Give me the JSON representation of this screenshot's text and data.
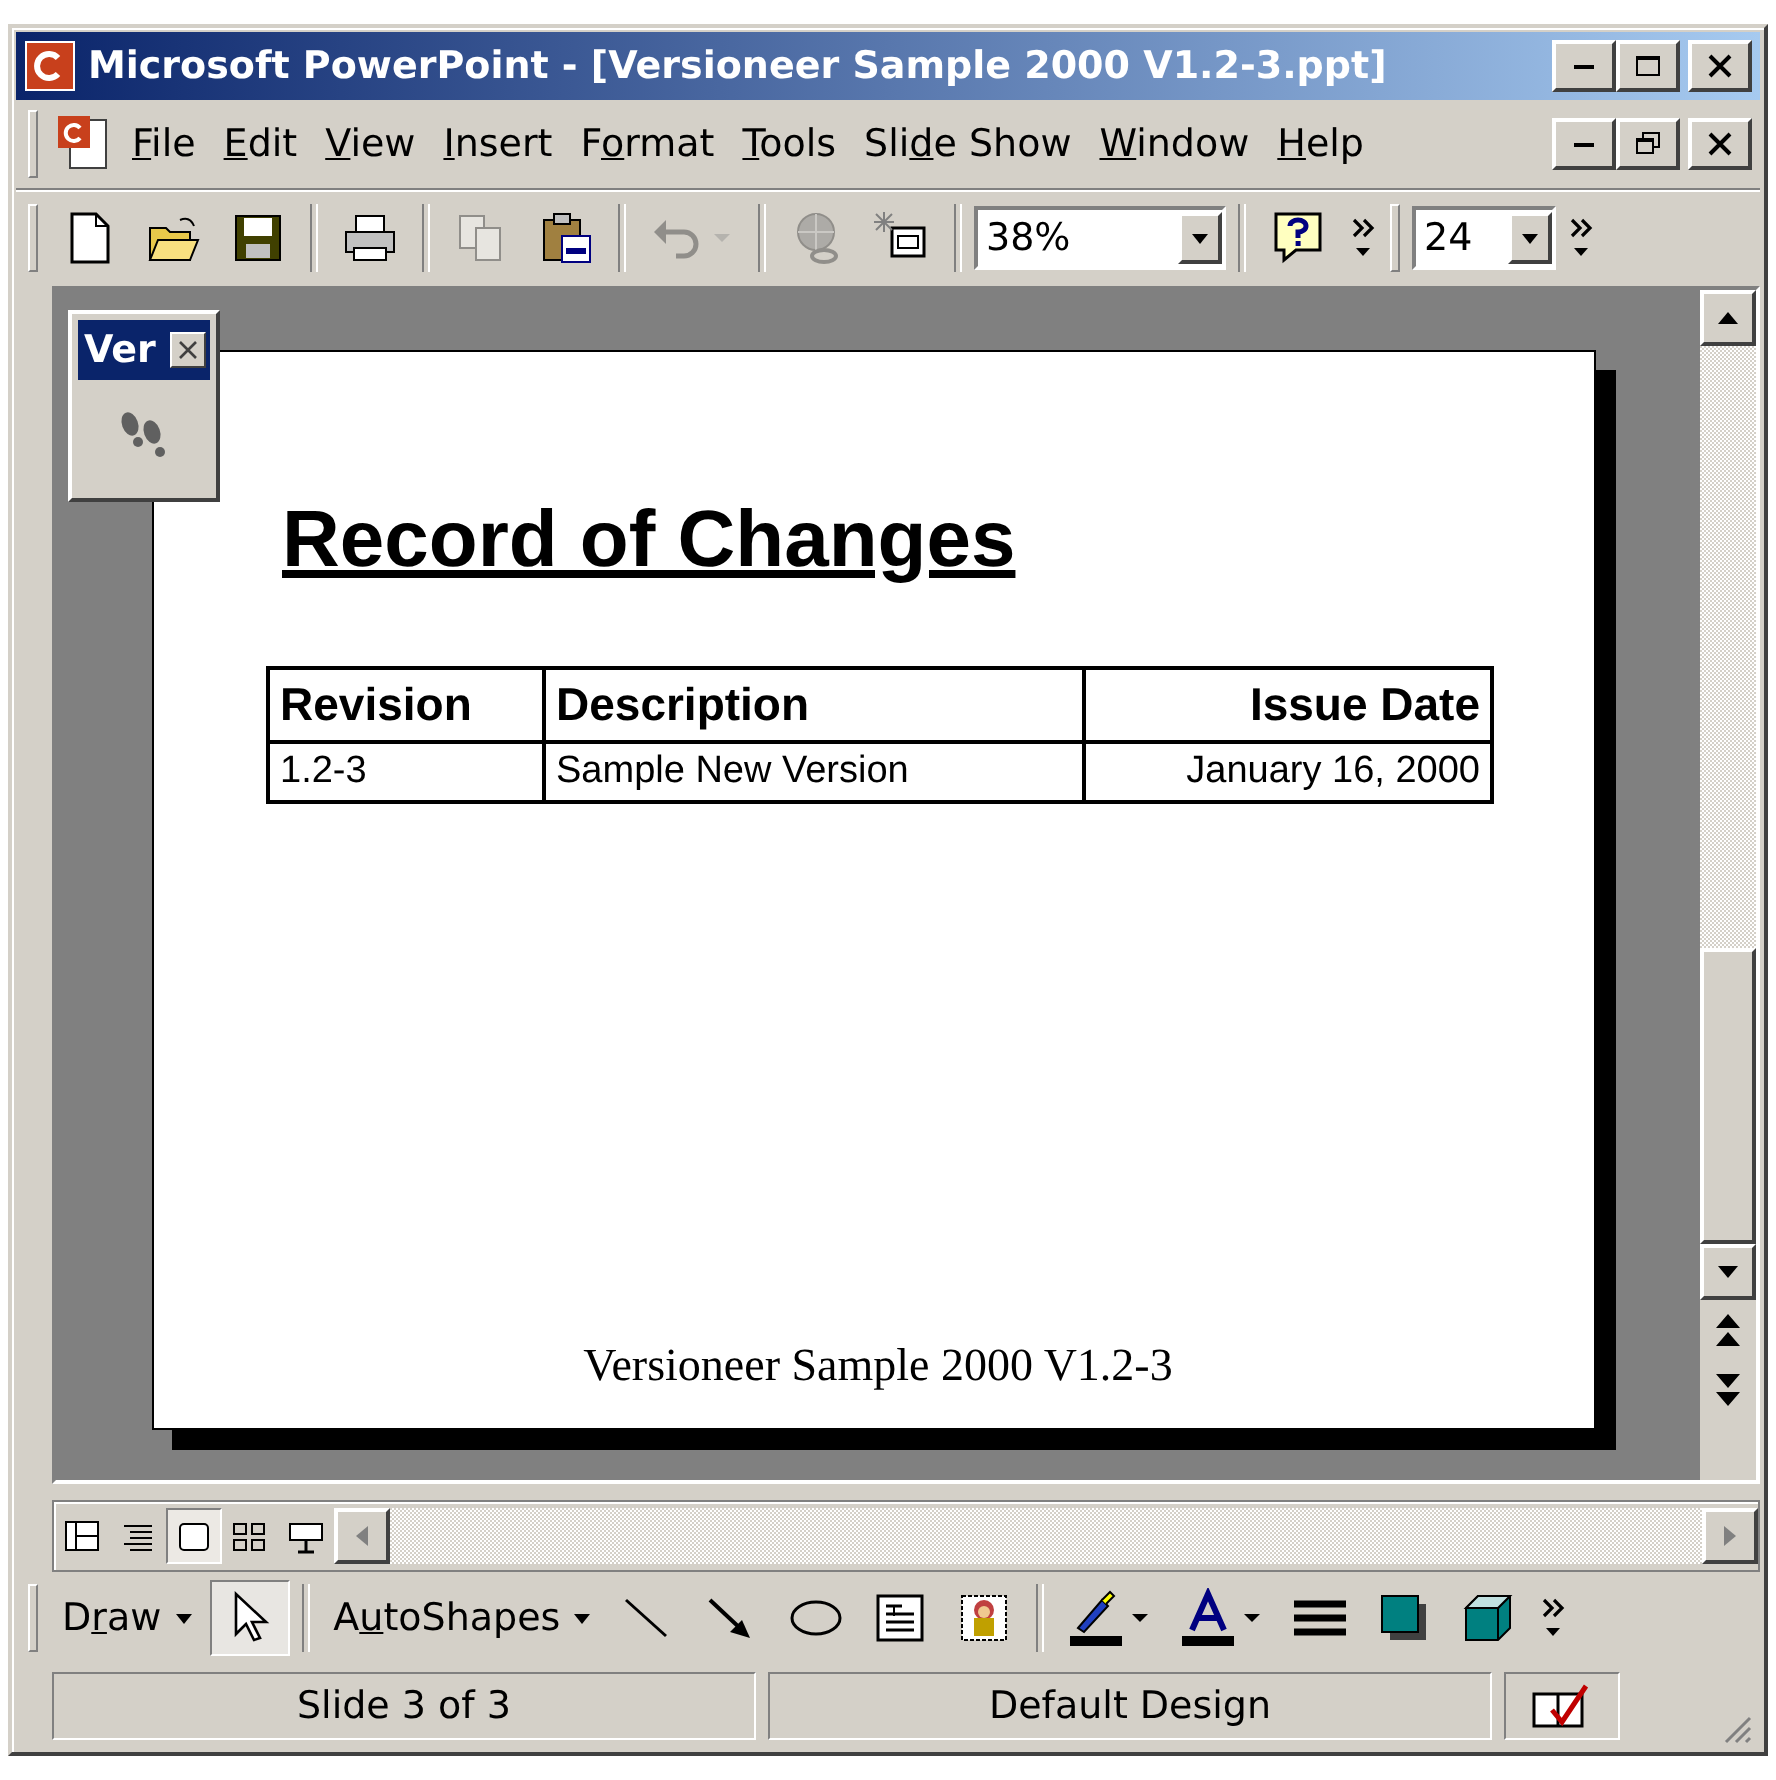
{
  "window": {
    "title": "Microsoft PowerPoint - [Versioneer Sample 2000 V1.2-3.ppt]"
  },
  "menu": {
    "items": [
      {
        "label": [
          {
            "text": "F",
            "underline": true
          },
          {
            "text": "ile",
            "underline": false
          }
        ]
      },
      {
        "label": [
          {
            "text": "E",
            "underline": true
          },
          {
            "text": "dit",
            "underline": false
          }
        ]
      },
      {
        "label": [
          {
            "text": "V",
            "underline": true
          },
          {
            "text": "iew",
            "underline": false
          }
        ]
      },
      {
        "label": [
          {
            "text": "I",
            "underline": true
          },
          {
            "text": "nsert",
            "underline": false
          }
        ]
      },
      {
        "label": [
          {
            "text": "F",
            "underline": false
          },
          {
            "text": "o",
            "underline": true
          },
          {
            "text": "rmat",
            "underline": false
          }
        ]
      },
      {
        "label": [
          {
            "text": "T",
            "underline": true
          },
          {
            "text": "ools",
            "underline": false
          }
        ]
      },
      {
        "label": [
          {
            "text": "Sli",
            "underline": false
          },
          {
            "text": "d",
            "underline": true
          },
          {
            "text": "e Show",
            "underline": false
          }
        ]
      },
      {
        "label": [
          {
            "text": "W",
            "underline": true
          },
          {
            "text": "indow",
            "underline": false
          }
        ]
      },
      {
        "label": [
          {
            "text": "H",
            "underline": true
          },
          {
            "text": "elp",
            "underline": false
          }
        ]
      }
    ]
  },
  "standard_toolbar": {
    "items": [
      {
        "kind": "button",
        "disabled": false
      },
      {
        "kind": "button",
        "disabled": false
      },
      {
        "kind": "button",
        "disabled": false
      },
      {
        "kind": "separator"
      },
      {
        "kind": "button",
        "disabled": false
      },
      {
        "kind": "separator"
      },
      {
        "kind": "button",
        "disabled": true
      },
      {
        "kind": "button",
        "disabled": false
      },
      {
        "kind": "separator"
      },
      {
        "kind": "split",
        "disabled": true
      },
      {
        "kind": "separator"
      },
      {
        "kind": "button",
        "disabled": true
      },
      {
        "kind": "button",
        "disabled": false
      },
      {
        "kind": "separator"
      },
      {
        "kind": "zoom_combo",
        "value": "38%"
      },
      {
        "kind": "separator"
      },
      {
        "kind": "button",
        "disabled": false
      },
      {
        "kind": "chevron"
      },
      {
        "kind": "grip"
      },
      {
        "kind": "font_size_combo",
        "value": "24"
      },
      {
        "kind": "chevron"
      }
    ]
  },
  "floating_toolbar": {
    "title": "Ver"
  },
  "slide": {
    "title": "Record of Changes",
    "table": {
      "columns": [
        "Revision",
        "Description",
        "Issue Date"
      ],
      "rows": [
        [
          "1.2-3",
          "Sample New Version",
          "January 16, 2000"
        ]
      ]
    },
    "footer": "Versioneer Sample 2000 V1.2-3"
  },
  "view_buttons": [
    {
      "selected": false
    },
    {
      "selected": false
    },
    {
      "selected": true
    },
    {
      "selected": false
    },
    {
      "selected": false
    }
  ],
  "drawing_toolbar": {
    "items": [
      {
        "kind": "menu",
        "label": [
          {
            "text": "D",
            "underline": false
          },
          {
            "text": "r",
            "underline": true
          },
          {
            "text": "aw",
            "underline": false
          }
        ]
      },
      {
        "kind": "button",
        "pressed": true
      },
      {
        "kind": "separator"
      },
      {
        "kind": "menu",
        "label": [
          {
            "text": "A",
            "underline": false
          },
          {
            "text": "u",
            "underline": true
          },
          {
            "text": "toShapes",
            "underline": false
          }
        ]
      },
      {
        "kind": "button",
        "pressed": false
      },
      {
        "kind": "button",
        "pressed": false
      },
      {
        "kind": "button",
        "pressed": false
      },
      {
        "kind": "button",
        "pressed": false
      },
      {
        "kind": "button",
        "pressed": false
      },
      {
        "kind": "separator"
      },
      {
        "kind": "split",
        "pressed": false
      },
      {
        "kind": "split",
        "pressed": false
      },
      {
        "kind": "button",
        "pressed": false
      },
      {
        "kind": "button",
        "pressed": false
      },
      {
        "kind": "button",
        "pressed": false
      },
      {
        "kind": "chevron"
      }
    ]
  },
  "status_bar": {
    "slide": "Slide 3 of 3",
    "design": "Default Design"
  }
}
